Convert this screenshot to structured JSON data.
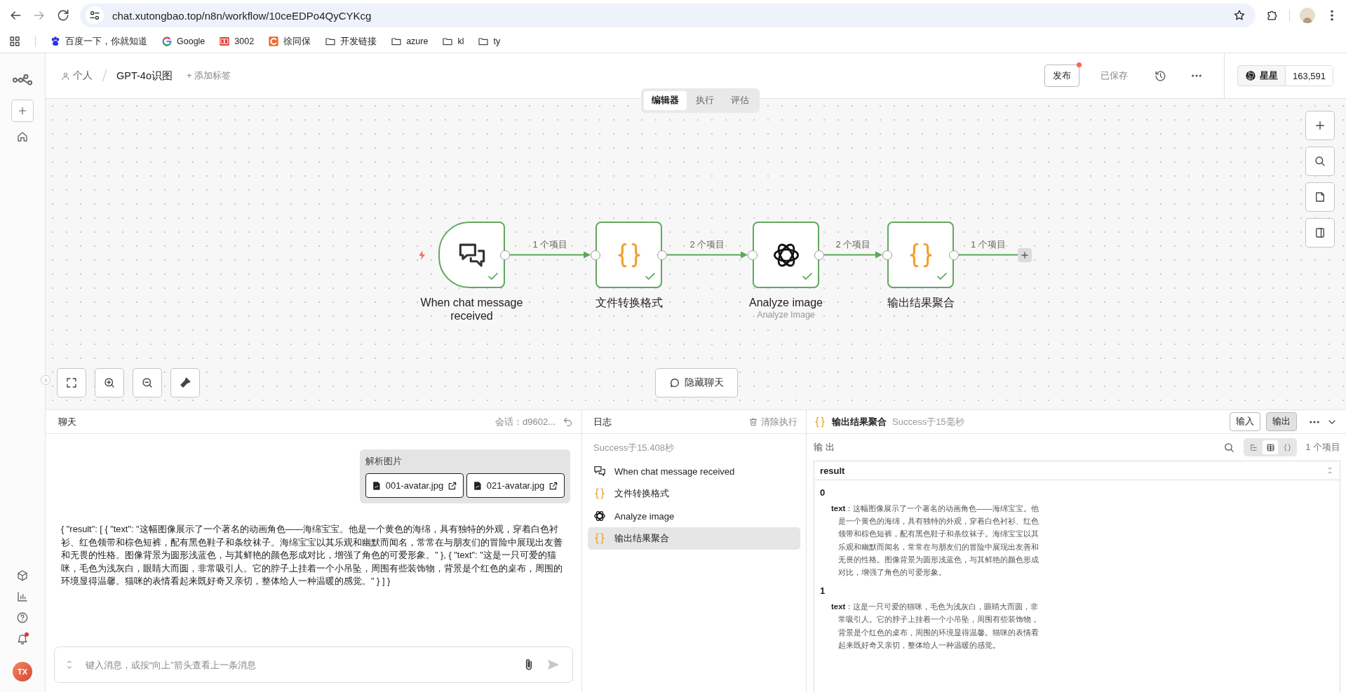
{
  "browser": {
    "url": "chat.xutongbao.top/n8n/workflow/10ceEDPo4QyCYKcg",
    "bookmarks": [
      {
        "kind": "paw",
        "label": "百度一下，你就知道"
      },
      {
        "kind": "ring",
        "label": "Google"
      },
      {
        "kind": "book",
        "label": "3002"
      },
      {
        "kind": "arc",
        "label": "徐同保"
      },
      {
        "kind": "folder",
        "label": "开发链接"
      },
      {
        "kind": "folder",
        "label": "azure"
      },
      {
        "kind": "folder",
        "label": "kl"
      },
      {
        "kind": "folder",
        "label": "ty"
      }
    ]
  },
  "sidebar": {
    "avatar": "TX",
    "notification_dot": true
  },
  "header": {
    "breadcrumb": [
      "个人",
      "GPT-4o识图"
    ],
    "add_tag": "+ 添加标签",
    "publish": {
      "label": "发布",
      "unpublished_changes": true
    },
    "saved": "已保存",
    "github": {
      "label": "星星",
      "count": "163,591"
    }
  },
  "tabs": [
    {
      "label": "编辑器",
      "selected": true
    },
    {
      "label": "执行",
      "selected": false
    },
    {
      "label": "评估",
      "selected": false
    }
  ],
  "nodes": [
    {
      "kind": "trigger",
      "title": "When chat message received",
      "success": true
    },
    {
      "kind": "code",
      "title": "文件转换格式",
      "success": true
    },
    {
      "kind": "ai",
      "title": "Analyze image",
      "subtitle": "Analyze Image",
      "success": true
    },
    {
      "kind": "code",
      "title": "输出结果聚合",
      "success": true
    }
  ],
  "connections": [
    {
      "label": "1 个项目"
    },
    {
      "label": "2 个项目"
    },
    {
      "label": "2 个项目"
    },
    {
      "label": "1 个项目"
    }
  ],
  "hide_chat": "隐藏聊天",
  "chat": {
    "title": "聊天",
    "session": "会话：d9602...",
    "message": {
      "title": "解析图片",
      "files": [
        "001-avatar.jpg",
        "021-avatar.jpg"
      ]
    },
    "response": "{ \"result\": [ { \"text\": \"这幅图像展示了一个著名的动画角色——海绵宝宝。他是一个黄色的海绵，具有独特的外观，穿着白色衬衫、红色领带和棕色短裤，配有黑色鞋子和条纹袜子。海绵宝宝以其乐观和幽默而闻名，常常在与朋友们的冒险中展现出友善和无畏的性格。图像背景为圆形浅蓝色，与其鲜艳的颜色形成对比，增强了角色的可爱形象。\" }, { \"text\": \"这是一只可爱的猫咪，毛色为浅灰白，眼睛大而圆，非常吸引人。它的脖子上挂着一个小吊坠，周围有些装饰物，背景是个红色的桌布，周围的环境显得温馨。猫咪的表情看起来既好奇又亲切，整体给人一种温暖的感觉。\" } ] }",
    "placeholder": "键入消息，或按“向上”箭头查看上一条消息"
  },
  "log": {
    "title": "日志",
    "clear": "清除执行",
    "summary": "Success于15.408秒",
    "items": [
      {
        "kind": "trigger",
        "label": "When chat message received",
        "selected": false
      },
      {
        "kind": "code",
        "label": "文件转换格式",
        "selected": false
      },
      {
        "kind": "ai",
        "label": "Analyze image",
        "selected": false
      },
      {
        "kind": "code",
        "label": "输出结果聚合",
        "selected": true
      }
    ]
  },
  "output": {
    "title": "输出结果聚合",
    "status": "Success于15毫秒",
    "modes": [
      {
        "label": "输入",
        "selected": false
      },
      {
        "label": "输出",
        "selected": true
      }
    ],
    "section": "输 出",
    "views": [
      {
        "kind": "schema",
        "selected": false
      },
      {
        "kind": "table",
        "selected": true
      },
      {
        "kind": "json",
        "selected": false
      }
    ],
    "count": "1 个项目",
    "column": "result",
    "items": [
      {
        "index": "0",
        "line": "**text**：这幅图像展示了一个著名的动画角色——海绵宝宝。他是一个黄色的海绵，具有独特的外观，穿着白色衬衫、红色领带和棕色短裤，配有黑色鞋子和条纹袜子。海绵宝宝以其乐观和幽默而闻名，常常在与朋友们的冒险中展现出友善和无畏的性格。图像背景为圆形浅蓝色，与其鲜艳的颜色形成对比，增强了角色的可爱形象。"
      },
      {
        "index": "1",
        "line": "**text**：这是一只可爱的猫咪，毛色为浅灰白，眼睛大而圆，非常吸引人。它的脖子上挂着一个小吊坠，周围有些装饰物，背景是个红色的桌布，周围的环境显得温馨。猫咪的表情看起来既好奇又亲切，整体给人一种温暖的感觉。"
      }
    ]
  }
}
